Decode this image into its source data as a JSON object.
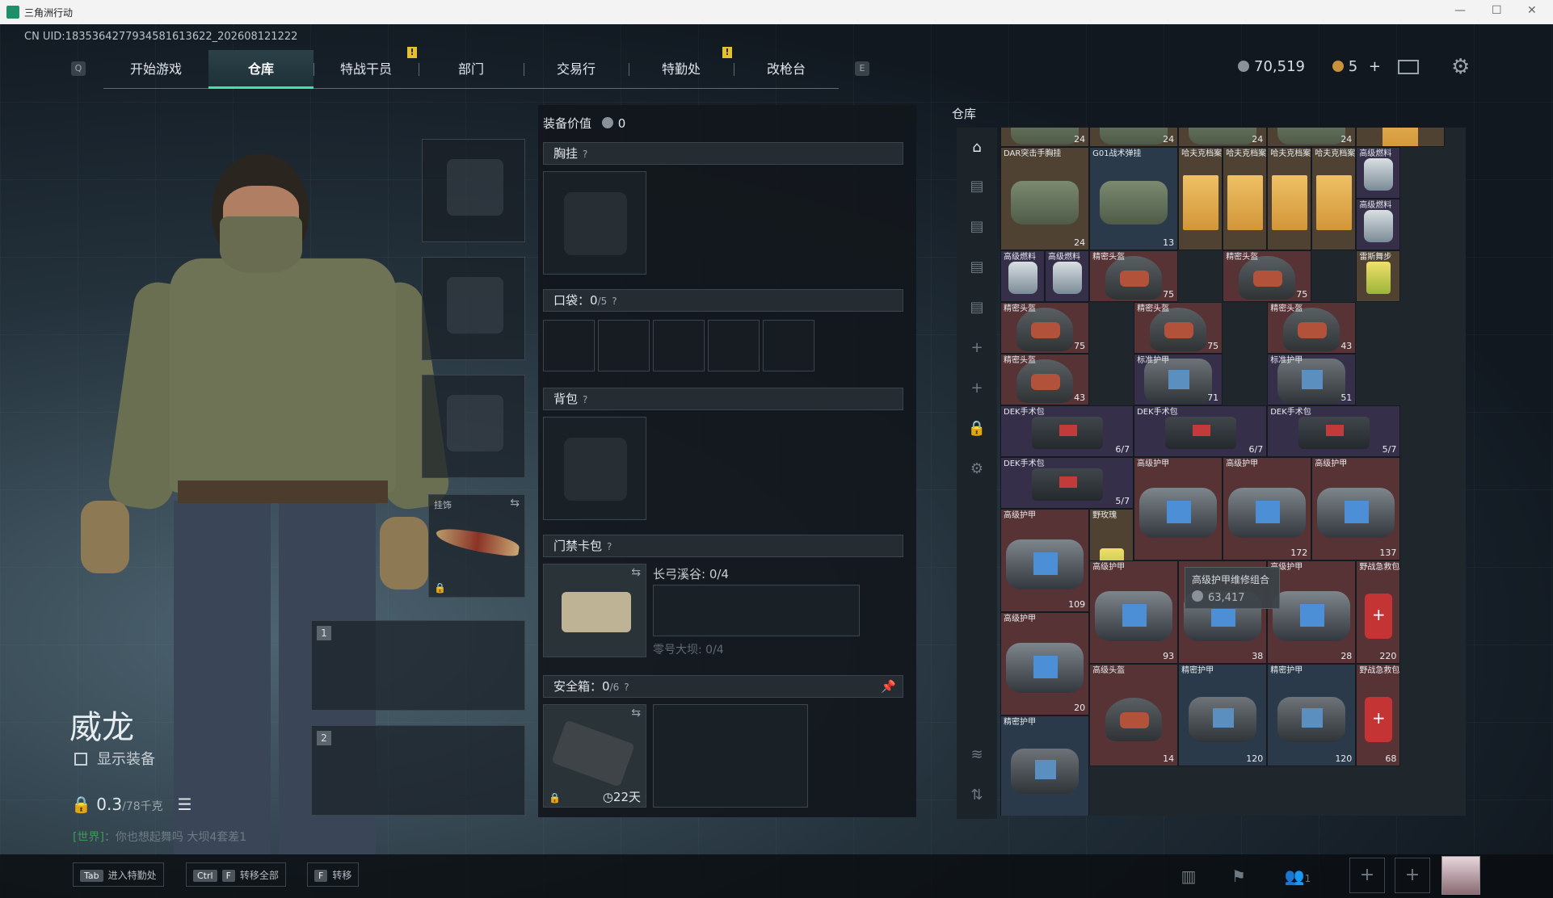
{
  "window": {
    "title": "三角洲行动",
    "min": "—",
    "max": "☐",
    "close": "✕"
  },
  "uid": "CN UID:1835364277934581613622_202608121222",
  "nav": {
    "key_left": "Q",
    "key_right": "E",
    "tabs": [
      "开始游戏",
      "仓库",
      "特战干员",
      "部门",
      "交易行",
      "特勤处",
      "改枪台"
    ],
    "selected_index": 1,
    "alert": "!"
  },
  "currency": {
    "coins": "70,519",
    "gold": "5",
    "plus": "+"
  },
  "character": {
    "name": "威龙",
    "show_equipment": "显示装备",
    "weight_value": "0.3",
    "weight_max": "/78千克"
  },
  "chat": {
    "channel": "[世界]",
    "text": "：你也想起舞吗",
    "highlight": "大坝4套差1"
  },
  "slots": {
    "pendant_label": "挂饰",
    "weapon1_num": "1",
    "weapon2_num": "2"
  },
  "equipment": {
    "value_label": "装备价值",
    "value": "0",
    "chest": "胸挂",
    "help": "?",
    "pocket": "口袋：",
    "pocket_count": "0",
    "pocket_cap": "/5",
    "backpack": "背包",
    "keycard": "门禁卡包",
    "key1": "长弓溪谷: 0/4",
    "key2": "零号大坝: 0/4",
    "safe": "安全箱：",
    "safe_count": "0",
    "safe_cap": "/6",
    "safe_days": "22天"
  },
  "storage": {
    "title": "仓库",
    "items": [
      {
        "name": "",
        "count": "24",
        "cls": "gold",
        "pic": "bag"
      },
      {
        "name": "",
        "count": "24",
        "cls": "gold",
        "pic": "bag"
      },
      {
        "name": "",
        "count": "24",
        "cls": "gold",
        "pic": "bag"
      },
      {
        "name": "",
        "count": "24",
        "cls": "gold",
        "pic": "bag"
      },
      {
        "name": "",
        "count": "",
        "cls": "gold",
        "pic": "file"
      },
      {
        "name": "DAR突击手胸挂",
        "count": "24",
        "cls": "gold",
        "pic": "bag"
      },
      {
        "name": "G01战术弹挂",
        "count": "13",
        "cls": "blue",
        "pic": "bag"
      },
      {
        "name": "哈夫克档案",
        "count": "",
        "cls": "gold",
        "pic": "file"
      },
      {
        "name": "哈夫克档案",
        "count": "",
        "cls": "gold",
        "pic": "file"
      },
      {
        "name": "哈夫克档案",
        "count": "",
        "cls": "gold",
        "pic": "file"
      },
      {
        "name": "哈夫克档案",
        "count": "",
        "cls": "gold",
        "pic": "file"
      },
      {
        "name": "高级燃料",
        "count": "",
        "cls": "purple",
        "pic": "fuel"
      },
      {
        "name": "高级燃料",
        "count": "",
        "cls": "purple",
        "pic": "fuel"
      },
      {
        "name": "高级燃料",
        "count": "",
        "cls": "purple",
        "pic": "fuel"
      },
      {
        "name": "高级燃料",
        "count": "",
        "cls": "purple",
        "pic": "fuel"
      },
      {
        "name": "精密头盔",
        "count": "75",
        "cls": "red",
        "pic": "helm"
      },
      {
        "name": "精密头盔",
        "count": "75",
        "cls": "red",
        "pic": "helm"
      },
      {
        "name": "雷斯舞步",
        "count": "",
        "cls": "gold",
        "pic": "drink"
      },
      {
        "name": "精密头盔",
        "count": "75",
        "cls": "red",
        "pic": "helm"
      },
      {
        "name": "精密头盔",
        "count": "75",
        "cls": "red",
        "pic": "helm"
      },
      {
        "name": "精密头盔",
        "count": "43",
        "cls": "red",
        "pic": "helm"
      },
      {
        "name": "精密头盔",
        "count": "43",
        "cls": "red",
        "pic": "helm"
      },
      {
        "name": "标准护甲",
        "count": "71",
        "cls": "purple",
        "pic": "armor2"
      },
      {
        "name": "标准护甲",
        "count": "51",
        "cls": "purple",
        "pic": "armor2"
      },
      {
        "name": "DEK手术包",
        "count": "6/7",
        "cls": "purple",
        "pic": "medk"
      },
      {
        "name": "DEK手术包",
        "count": "6/7",
        "cls": "purple",
        "pic": "medk"
      },
      {
        "name": "DEK手术包",
        "count": "5/7",
        "cls": "purple",
        "pic": "medk"
      },
      {
        "name": "DEK手术包",
        "count": "5/7",
        "cls": "purple",
        "pic": "medk"
      },
      {
        "name": "高级护甲",
        "count": "",
        "cls": "red",
        "pic": "armor"
      },
      {
        "name": "高级护甲",
        "count": "172",
        "cls": "red",
        "pic": "armor"
      },
      {
        "name": "高级护甲",
        "count": "137",
        "cls": "red",
        "pic": "armor"
      },
      {
        "name": "高级护甲",
        "count": "109",
        "cls": "red",
        "pic": "armor"
      },
      {
        "name": "野玫瑰",
        "count": "",
        "cls": "gold",
        "pic": "drink"
      },
      {
        "name": "高级护甲",
        "count": "93",
        "cls": "red",
        "pic": "armor"
      },
      {
        "name": "",
        "count": "38",
        "cls": "red",
        "pic": "armor"
      },
      {
        "name": "高级护甲",
        "count": "28",
        "cls": "red",
        "pic": "armor"
      },
      {
        "name": "野战急救包",
        "count": "220",
        "cls": "red",
        "pic": "first"
      },
      {
        "name": "高级护甲",
        "count": "20",
        "cls": "red",
        "pic": "armor"
      },
      {
        "name": "高级头盔",
        "count": "14",
        "cls": "red",
        "pic": "helm"
      },
      {
        "name": "精密护甲",
        "count": "120",
        "cls": "blue",
        "pic": "armor2"
      },
      {
        "name": "精密护甲",
        "count": "120",
        "cls": "blue",
        "pic": "armor2"
      },
      {
        "name": "野战急救包",
        "count": "68",
        "cls": "red",
        "pic": "first"
      },
      {
        "name": "精密护甲",
        "count": "",
        "cls": "blue",
        "pic": "armor2"
      }
    ],
    "tooltip_name": "高级护甲维修组合",
    "tooltip_value": "63,417"
  },
  "bottom": {
    "hint1_key": "Tab",
    "hint1": "进入特勤处",
    "hint2_key1": "Ctrl",
    "hint2_key2": "F",
    "hint2": "转移全部",
    "hint3_key": "F",
    "hint3": "转移",
    "friends": "1"
  }
}
